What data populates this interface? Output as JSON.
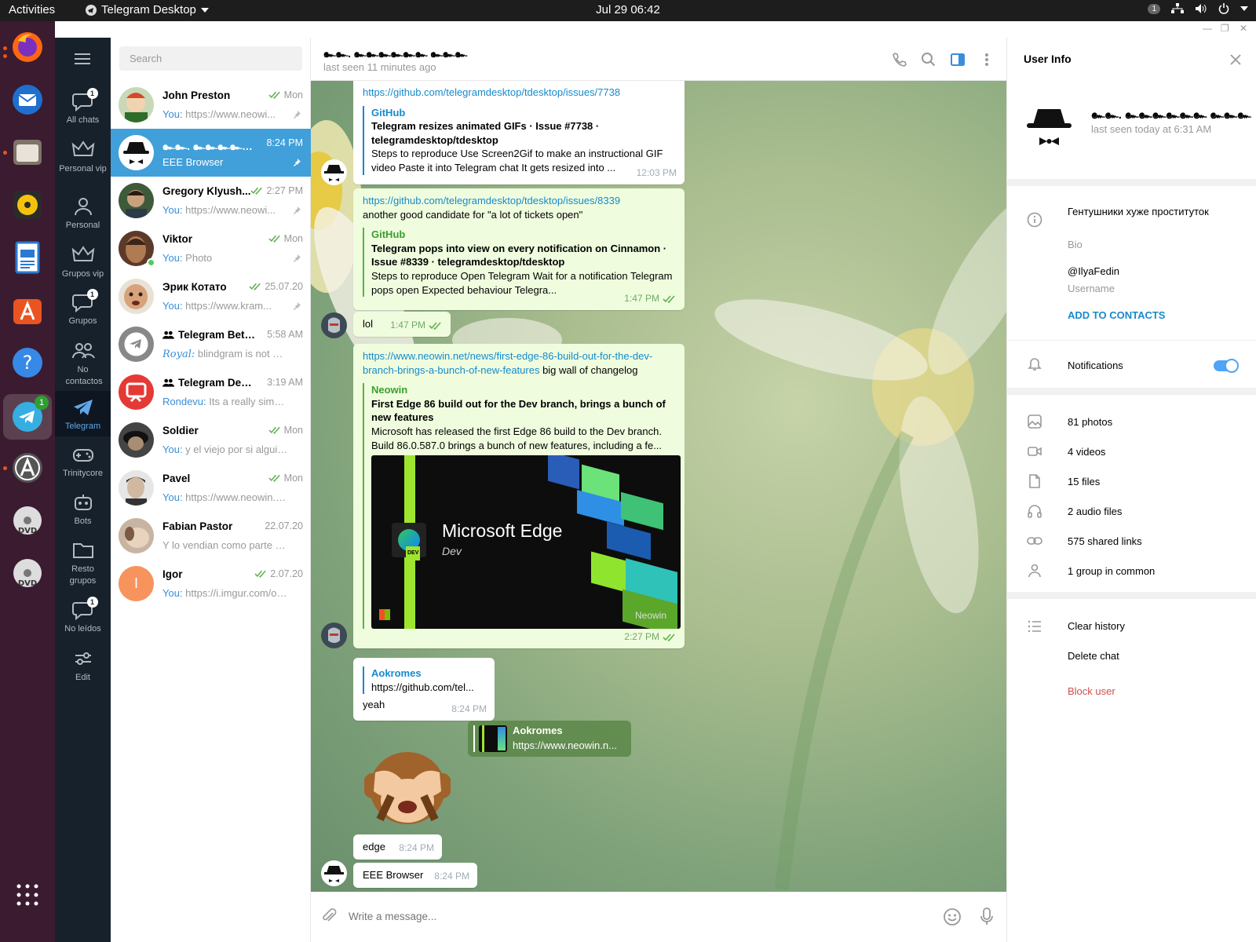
{
  "topbar": {
    "activities": "Activities",
    "app_name": "Telegram Desktop",
    "clock": "Jul 29  06:42",
    "notif_count": "1"
  },
  "dock": {
    "telegram_badge": "1"
  },
  "folders": [
    {
      "label": "All chats",
      "badge": "1"
    },
    {
      "label": "Personal vip",
      "badge": ""
    },
    {
      "label": "Personal",
      "badge": ""
    },
    {
      "label": "Grupos vip",
      "badge": ""
    },
    {
      "label": "Grupos",
      "badge": "1"
    },
    {
      "label": "No contactos",
      "badge": ""
    },
    {
      "label": "Telegram",
      "badge": ""
    },
    {
      "label": "Trinitycore",
      "badge": ""
    },
    {
      "label": "Bots",
      "badge": ""
    },
    {
      "label": "Resto grupos",
      "badge": ""
    },
    {
      "label": "No leídos",
      "badge": "1"
    },
    {
      "label": "Edit",
      "badge": ""
    }
  ],
  "search": {
    "placeholder": "Search"
  },
  "chats": [
    {
      "name": "John Preston",
      "time": "Mon",
      "sender": "You:",
      "preview": " https://www.neowi...",
      "checks": true,
      "pinned": true
    },
    {
      "name": "๛๛. ๛๛๛๛๛๛ ๛๛๛",
      "time": "8:24 PM",
      "sender": "",
      "preview": "EEE Browser",
      "checks": false,
      "pinned": true
    },
    {
      "name": "Gregory Klyush...",
      "time": "2:27 PM",
      "sender": "You:",
      "preview": " https://www.neowi...",
      "checks": true,
      "pinned": true
    },
    {
      "name": "Viktor",
      "time": "Mon",
      "sender": "You:",
      "preview": " Photo",
      "checks": true,
      "pinned": true
    },
    {
      "name": "Эрик Котато",
      "time": "25.07.20",
      "sender": "You:",
      "preview": " https://www.kram...",
      "checks": true,
      "pinned": true
    },
    {
      "name": "Telegram Beta ...",
      "time": "5:58 AM",
      "sender": "Royal:",
      "preview": " blindgram is not offic...",
      "checks": false,
      "pinned": false
    },
    {
      "name": "Telegram Desk...",
      "time": "3:19 AM",
      "sender": "Rondevu:",
      "preview": " Its a really simple ...",
      "checks": false,
      "pinned": false
    },
    {
      "name": "Soldier",
      "time": "Mon",
      "sender": "You:",
      "preview": " y el viejo por si alguien ...",
      "checks": true,
      "pinned": false
    },
    {
      "name": "Pavel",
      "time": "Mon",
      "sender": "You:",
      "preview": " https://www.neowin.ne...",
      "checks": true,
      "pinned": false
    },
    {
      "name": "Fabian Pastor",
      "time": "22.07.20",
      "sender": "",
      "preview": "Y lo vendian como parte de ...",
      "checks": false,
      "pinned": false
    },
    {
      "name": "Igor",
      "time": "2.07.20",
      "sender": "You:",
      "preview": " https://i.imgur.com/oN...",
      "checks": true,
      "pinned": false
    }
  ],
  "igor_initial": "I",
  "chat": {
    "title": "๛๛. ๛๛๛๛๛๛ ๛๛๛",
    "status": "last seen 11 minutes ago",
    "composer_placeholder": "Write a message..."
  },
  "messages": {
    "m1": {
      "link": "https://github.com/telegramdesktop/tdesktop/issues/7738",
      "site": "GitHub",
      "title": "Telegram resizes animated GIFs · Issue #7738 · telegramdesktop/tdesktop",
      "desc": "Steps to reproduce Use Screen2Gif to make an instructional GIF video Paste it into Telegram chat It gets resized into ...",
      "time": "12:03 PM"
    },
    "m2": {
      "link": "https://github.com/telegramdesktop/tdesktop/issues/8339",
      "text": "another good candidate for \"a lot of tickets open\"",
      "site": "GitHub",
      "title": "Telegram pops into view on every notification on Cinnamon · Issue #8339 · telegramdesktop/tdesktop",
      "desc": "Steps to reproduce Open Telegram Wait for a notification Telegram pops open Expected behaviour Telegra...",
      "time": "1:47 PM"
    },
    "m3": {
      "text": "lol",
      "time": "1:47 PM"
    },
    "m4": {
      "link": "https://www.neowin.net/news/first-edge-86-build-out-for-the-dev-branch-brings-a-bunch-of-new-features",
      "text": " big wall of changelog",
      "site": "Neowin",
      "title": "First Edge 86 build out for the Dev branch, brings a bunch of new features",
      "desc": "Microsoft has released the first Edge 86 build to the Dev branch. Build 86.0.587.0 brings a bunch of new features, including a fe...",
      "img_title": "Microsoft Edge",
      "img_sub": "Dev",
      "img_badge": "DEV",
      "img_brand": "Neowin",
      "time": "2:27 PM"
    },
    "m5": {
      "reply_name": "Aokromes",
      "reply_text": "https://github.com/tel...",
      "text": "yeah",
      "time": "8:24 PM"
    },
    "m6": {
      "reply_name": "Aokromes",
      "reply_text": "https://www.neowin.n..."
    },
    "m7": {
      "text": "edge",
      "time": "8:24 PM"
    },
    "m8": {
      "text": "EEE Browser",
      "time": "8:24 PM"
    }
  },
  "info": {
    "header": "User Info",
    "name": "๛๛. ๛๛๛๛๛๛ ๛๛๛",
    "status": "last seen today at 6:31 AM",
    "bio": "Гентушники хуже проституток",
    "bio_label": "Bio",
    "username": "@IlyaFedin",
    "username_label": "Username",
    "add_contacts": "ADD TO CONTACTS",
    "notifications": "Notifications",
    "notifications_on": true,
    "media": [
      "81 photos",
      "4 videos",
      "15 files",
      "2 audio files",
      "575 shared links",
      "1 group in common"
    ],
    "clear_history": "Clear history",
    "delete_chat": "Delete chat",
    "block_user": "Block user",
    "colors": {
      "accent": "#168acd",
      "danger": "#d14e4e",
      "selected": "#419fd9"
    }
  }
}
